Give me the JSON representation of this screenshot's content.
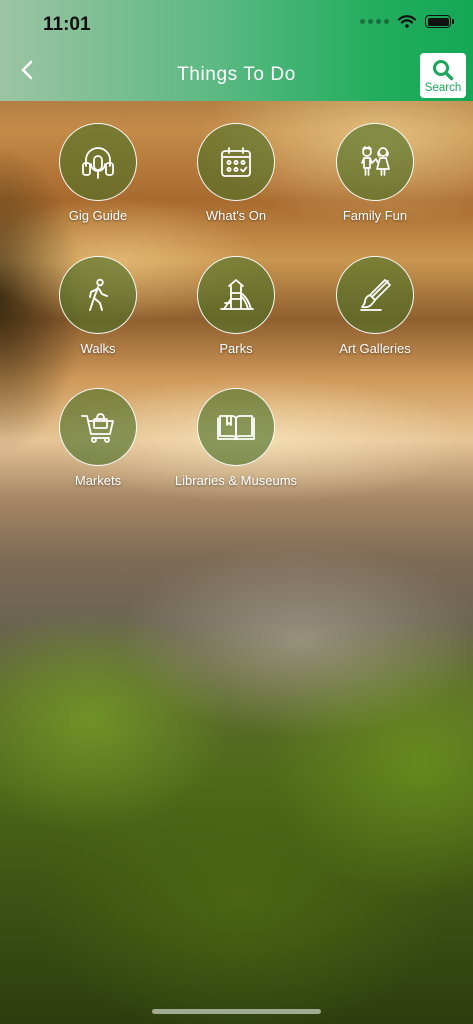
{
  "status_bar": {
    "time": "11:01"
  },
  "header": {
    "title": "Things To Do",
    "search_label": "Search",
    "accent_color": "#1aa85a"
  },
  "items": [
    {
      "label": "Gig Guide",
      "icon": "headphones-icon"
    },
    {
      "label": "What's On",
      "icon": "calendar-icon"
    },
    {
      "label": "Family Fun",
      "icon": "children-icon"
    },
    {
      "label": "Walks",
      "icon": "walking-person-icon"
    },
    {
      "label": "Parks",
      "icon": "playground-icon"
    },
    {
      "label": "Art Galleries",
      "icon": "paintbrush-icon"
    },
    {
      "label": "Markets",
      "icon": "shopping-cart-icon"
    },
    {
      "label": "Libraries & Museums",
      "icon": "book-icon"
    }
  ]
}
